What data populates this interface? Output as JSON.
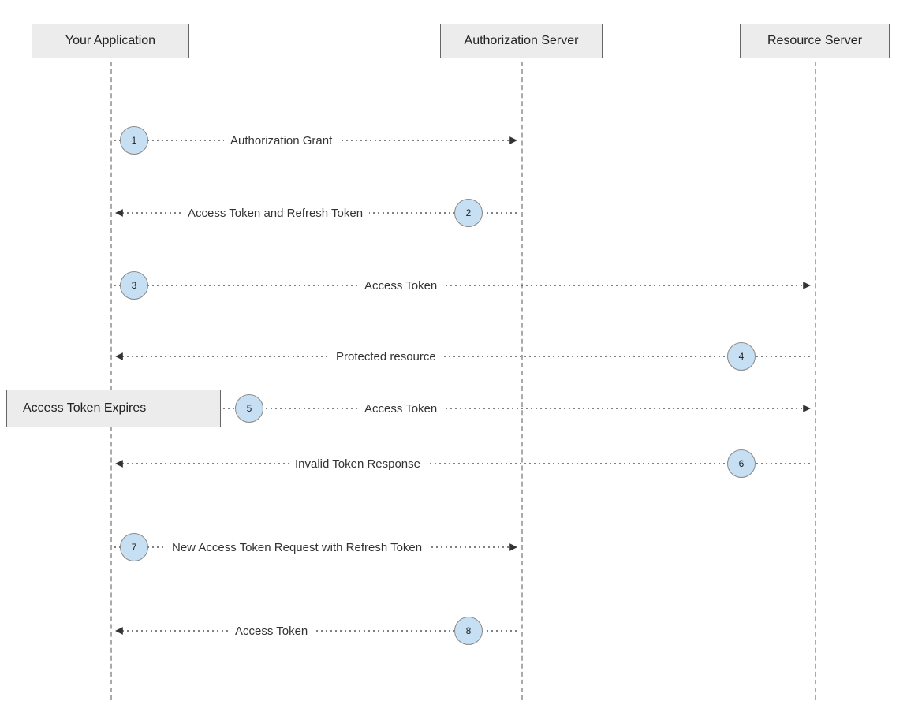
{
  "participants": {
    "your_app": "Your Application",
    "auth_server": "Authorization Server",
    "resource_server": "Resource Server"
  },
  "note": "Access Token Expires",
  "steps": {
    "s1": {
      "num": "1",
      "label": "Authorization Grant"
    },
    "s2": {
      "num": "2",
      "label": "Access Token and Refresh Token"
    },
    "s3": {
      "num": "3",
      "label": "Access Token"
    },
    "s4": {
      "num": "4",
      "label": "Protected resource"
    },
    "s5": {
      "num": "5",
      "label": "Access Token"
    },
    "s6": {
      "num": "6",
      "label": "Invalid Token Response"
    },
    "s7": {
      "num": "7",
      "label": "New Access Token Request with Refresh Token"
    },
    "s8": {
      "num": "8",
      "label": "Access Token"
    }
  }
}
